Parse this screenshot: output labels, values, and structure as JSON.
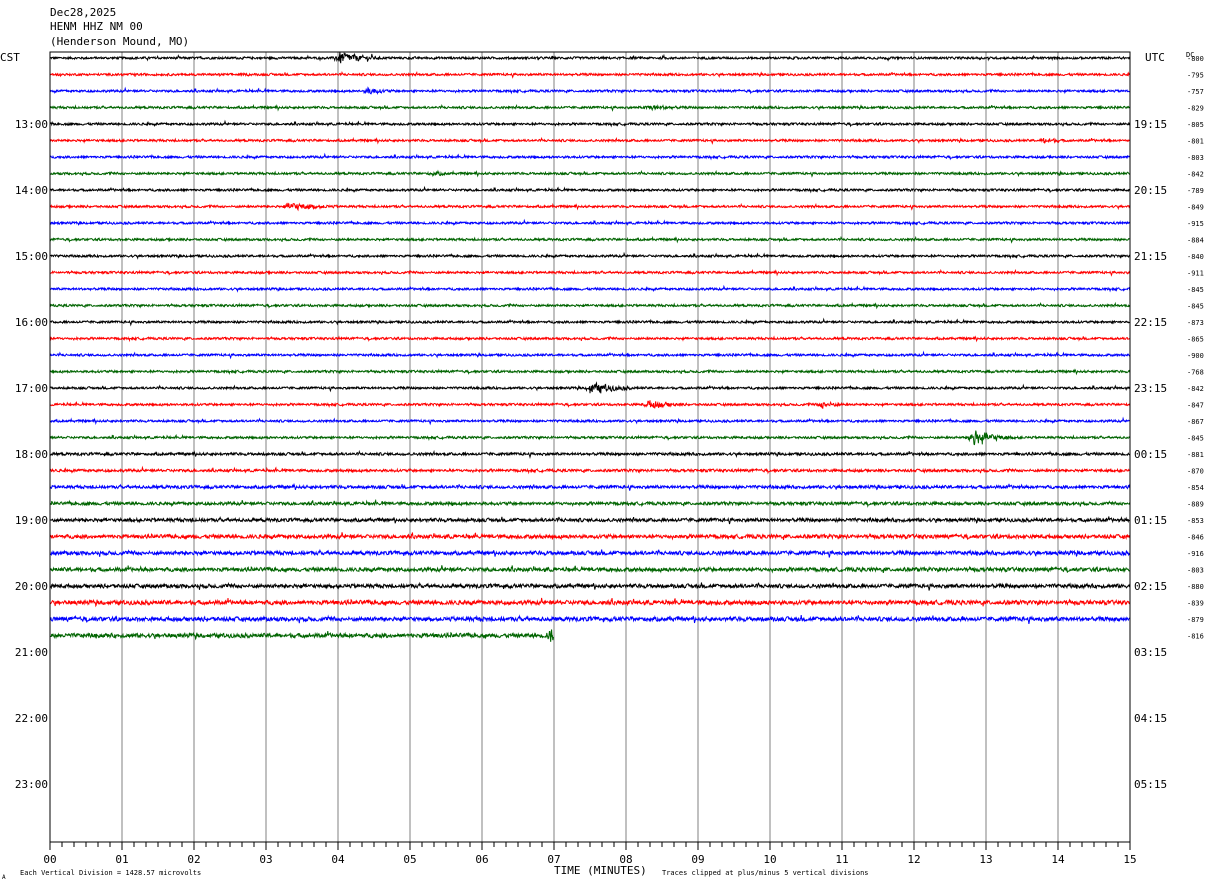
{
  "header": {
    "date": "Dec28,2025",
    "station": "HENM HHZ NM 00",
    "location": "(Henderson Mound, MO)"
  },
  "labels": {
    "left_tz": "CST",
    "right_tz": "UTC",
    "dc_label": "DC",
    "footer_left": "Each Vertical Division = 1428.57 microvolts",
    "footer_right": "Traces clipped at plus/minus 5 vertical divisions",
    "corner_mark": "A"
  },
  "colors": {
    "trace_cycle": [
      "#000000",
      "#ff0000",
      "#0000ff",
      "#006400"
    ],
    "grid": "#808080",
    "frame": "#000000",
    "background": "#ffffff"
  },
  "chart_data": {
    "type": "line",
    "title": "",
    "xlabel": "TIME (MINUTES)",
    "ylabel": "",
    "x_ticks": [
      "00",
      "01",
      "02",
      "03",
      "04",
      "05",
      "06",
      "07",
      "08",
      "09",
      "10",
      "11",
      "12",
      "13",
      "14",
      "15"
    ],
    "xlim": [
      0,
      15
    ],
    "grid": true,
    "time_axis_left": [
      "13:00",
      "14:00",
      "15:00",
      "16:00",
      "17:00",
      "18:00",
      "19:00",
      "20:00",
      "21:00",
      "22:00",
      "23:00"
    ],
    "time_axis_right": [
      "19:15",
      "20:15",
      "21:15",
      "22:15",
      "23:15",
      "00:15",
      "01:15",
      "02:15",
      "03:15",
      "04:15",
      "05:15"
    ],
    "trace_count": 36,
    "traces_per_hour": 4,
    "start_hour_cst": "12:00",
    "last_trace_end_minute": 7.0,
    "dc_offsets": [
      -800,
      -795,
      -757,
      -829,
      -805,
      -801,
      -803,
      -842,
      -789,
      -849,
      -915,
      -884,
      -840,
      -911,
      -845,
      -845,
      -873,
      -865,
      -900,
      -768,
      -842,
      -847,
      -867,
      -845,
      -881,
      -870,
      -854,
      -889,
      -853,
      -846,
      -916,
      -803,
      -880,
      -839,
      -879,
      -816
    ],
    "trace_amplitude": [
      0.3,
      0.3,
      0.3,
      0.3,
      0.3,
      0.3,
      0.3,
      0.3,
      0.3,
      0.3,
      0.3,
      0.3,
      0.3,
      0.3,
      0.3,
      0.3,
      0.3,
      0.3,
      0.3,
      0.3,
      0.3,
      0.3,
      0.3,
      0.3,
      0.35,
      0.35,
      0.4,
      0.4,
      0.45,
      0.5,
      0.5,
      0.5,
      0.5,
      0.55,
      0.55,
      0.55
    ],
    "events": [
      {
        "trace": 0,
        "minute": 4.0,
        "duration": 0.8,
        "amplitude": 1.8
      },
      {
        "trace": 2,
        "minute": 4.4,
        "duration": 0.6,
        "amplitude": 1.1
      },
      {
        "trace": 3,
        "minute": 8.3,
        "duration": 1.0,
        "amplitude": 0.9
      },
      {
        "trace": 5,
        "minute": 13.8,
        "duration": 0.6,
        "amplitude": 0.9
      },
      {
        "trace": 7,
        "minute": 5.3,
        "duration": 0.6,
        "amplitude": 0.8
      },
      {
        "trace": 9,
        "minute": 3.3,
        "duration": 1.2,
        "amplitude": 1.2
      },
      {
        "trace": 20,
        "minute": 7.5,
        "duration": 0.9,
        "amplitude": 1.6
      },
      {
        "trace": 21,
        "minute": 8.3,
        "duration": 0.8,
        "amplitude": 1.3
      },
      {
        "trace": 21,
        "minute": 10.7,
        "duration": 0.6,
        "amplitude": 1.1
      },
      {
        "trace": 23,
        "minute": 12.8,
        "duration": 0.7,
        "amplitude": 2.4
      },
      {
        "trace": 35,
        "minute": 6.95,
        "duration": 0.15,
        "amplitude": 2.5
      }
    ]
  }
}
